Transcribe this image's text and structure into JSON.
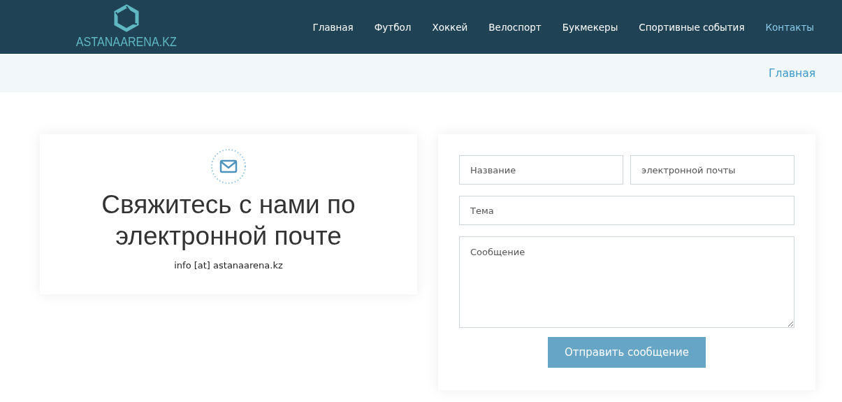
{
  "header": {
    "logo": "ASTANAARENA.KZ",
    "nav": [
      {
        "label": "Главная",
        "selected": false
      },
      {
        "label": "Футбол",
        "selected": false
      },
      {
        "label": "Хоккей",
        "selected": false
      },
      {
        "label": "Велоспорт",
        "selected": false
      },
      {
        "label": "Букмекеры",
        "selected": false
      },
      {
        "label": "Спортивные события",
        "selected": false
      },
      {
        "label": "Контакты",
        "selected": true
      }
    ]
  },
  "breadcrumb": [
    "Главная"
  ],
  "contact_card": {
    "title": "Свяжитесь с нами по электронной почте",
    "email": "info [at] astanaarena.kz"
  },
  "form": {
    "fields": [
      {
        "kind": "input",
        "placeholder": "Название"
      },
      {
        "kind": "input",
        "placeholder": "электронной почты"
      },
      {
        "kind": "input",
        "placeholder": "Тема"
      },
      {
        "kind": "textarea",
        "placeholder": "Сообщение"
      }
    ],
    "submit": "Отправить сообщение"
  }
}
